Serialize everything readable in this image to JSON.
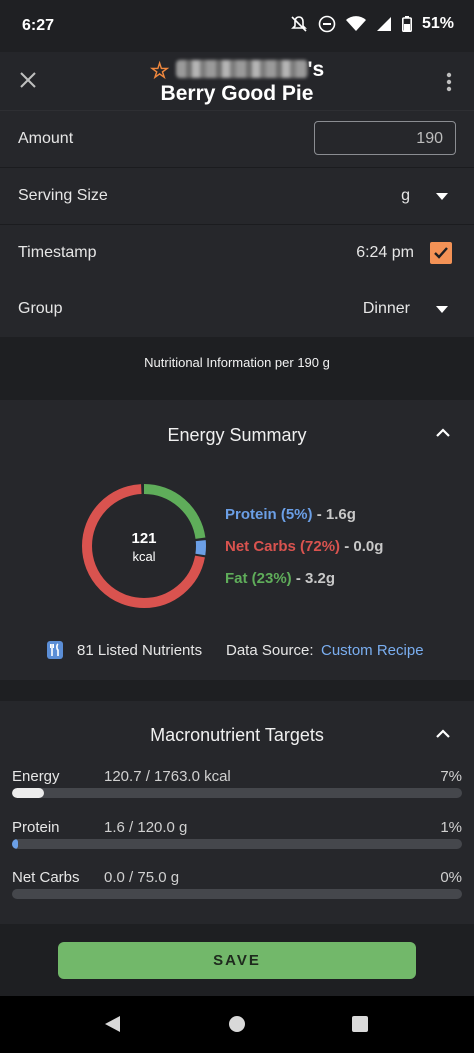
{
  "status": {
    "time": "6:27",
    "battery": "51%"
  },
  "header": {
    "title_prefix": "'s",
    "title": "Berry Good Pie"
  },
  "form": {
    "amount_label": "Amount",
    "amount_value": "190",
    "serving_label": "Serving Size",
    "serving_value": "g",
    "timestamp_label": "Timestamp",
    "timestamp_value": "6:24 pm",
    "timestamp_checked": true,
    "group_label": "Dinner",
    "group_field_label": "Group"
  },
  "info": "Nutritional Information per 190 g",
  "energy": {
    "title": "Energy Summary",
    "kcal_value": "121",
    "kcal_unit": "kcal",
    "legend": [
      {
        "name": "Protein (5%)",
        "value": "- 1.6g",
        "color": "#6b9fe6",
        "percent": 5
      },
      {
        "name": "Net Carbs (72%)",
        "value": "- 0.0g",
        "color": "#d9534f",
        "percent": 72
      },
      {
        "name": "Fat (23%)",
        "value": "- 3.2g",
        "color": "#5fad5a",
        "percent": 23
      }
    ],
    "nutrients_count": "81 Listed Nutrients",
    "data_source_label": "Data Source:",
    "data_source_value": "Custom Recipe"
  },
  "macros": {
    "title": "Macronutrient Targets",
    "rows": [
      {
        "name": "Energy",
        "value": "120.7 / 1763.0 kcal",
        "pct": "7%",
        "fraction": 0.07,
        "color": "#ececec"
      },
      {
        "name": "Protein",
        "value": "1.6 / 120.0 g",
        "pct": "1%",
        "fraction": 0.013,
        "color": "#6b9fe6"
      },
      {
        "name": "Net Carbs",
        "value": "0.0 / 75.0 g",
        "pct": "0%",
        "fraction": 0.0,
        "color": "#d9534f"
      }
    ]
  },
  "save_label": "SAVE",
  "colors": {
    "accent_orange": "#f39256",
    "save_green": "#72b86a"
  }
}
